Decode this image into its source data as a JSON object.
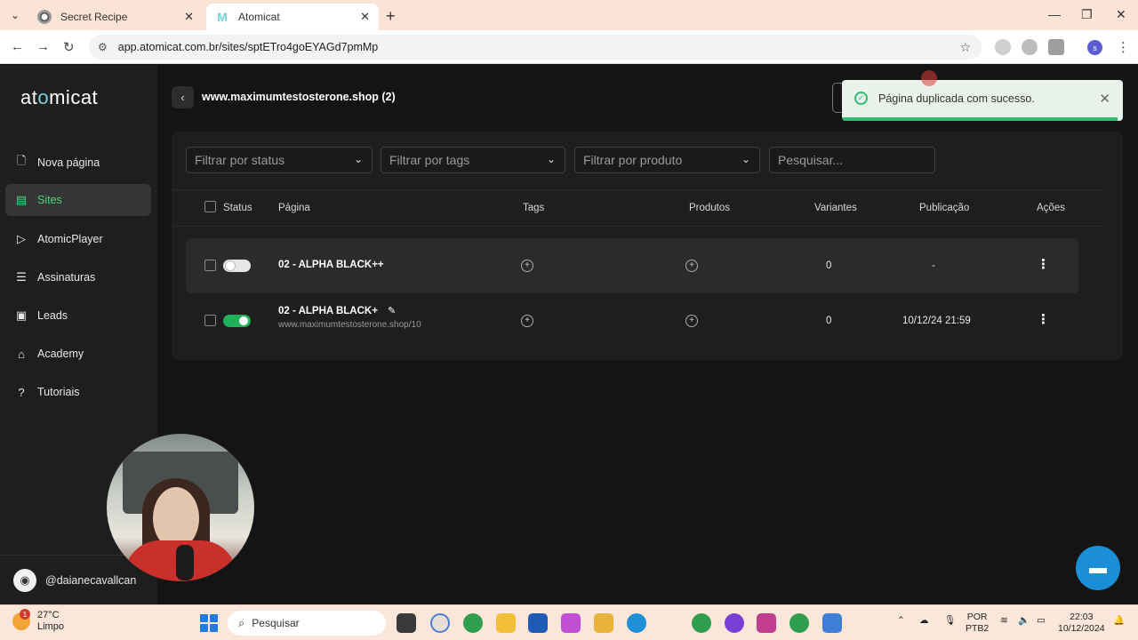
{
  "browser": {
    "tabs": [
      {
        "title": "Secret Recipe",
        "active": false
      },
      {
        "title": "Atomicat",
        "active": true
      }
    ],
    "url": "app.atomicat.com.br/sites/sptETro4goEYAGd7pmMp",
    "profile_initial": "s"
  },
  "sidebar": {
    "logo_pre": "at",
    "logo_dot": "o",
    "logo_post": "micat",
    "items": [
      {
        "label": "Nova página",
        "icon": "add-page-icon",
        "active": false
      },
      {
        "label": "Sites",
        "icon": "sites-icon",
        "active": true
      },
      {
        "label": "AtomicPlayer",
        "icon": "play-icon",
        "active": false
      },
      {
        "label": "Assinaturas",
        "icon": "list-icon",
        "active": false
      },
      {
        "label": "Leads",
        "icon": "leads-icon",
        "active": false
      },
      {
        "label": "Academy",
        "icon": "graduation-icon",
        "active": false
      },
      {
        "label": "Tutoriais",
        "icon": "help-icon",
        "active": false
      }
    ],
    "user": "@daianecavallcan"
  },
  "header": {
    "site_title": "www.maximumtestosterone.shop (2)"
  },
  "filters": {
    "status": "Filtrar por status",
    "tags": "Filtrar por tags",
    "produto": "Filtrar por produto",
    "search_placeholder": "Pesquisar..."
  },
  "table": {
    "columns": [
      "Status",
      "Página",
      "Tags",
      "Produtos",
      "Variantes",
      "Publicação",
      "Ações"
    ],
    "rows": [
      {
        "name": "02 - ALPHA BLACK++",
        "url": "",
        "status_on": false,
        "variantes": "0",
        "publicacao": "-"
      },
      {
        "name": "02 - ALPHA BLACK+",
        "url": "www.maximumtestosterone.shop/10",
        "status_on": true,
        "variantes": "0",
        "publicacao": "10/12/24 21:59"
      }
    ]
  },
  "toast": {
    "message": "Página duplicada com sucesso.",
    "progress": 0.98
  },
  "taskbar": {
    "weather_temp": "27°C",
    "weather_desc": "Limpo",
    "weather_badge": "1",
    "search_label": "Pesquisar",
    "lang_1": "POR",
    "lang_2": "PTB2",
    "time": "22:03",
    "date": "10/12/2024"
  },
  "colors": {
    "accent_green": "#4ad47f",
    "toggle_on": "#1fb25a",
    "toast_success": "#2fbf71",
    "chat": "#1a8fd8"
  }
}
